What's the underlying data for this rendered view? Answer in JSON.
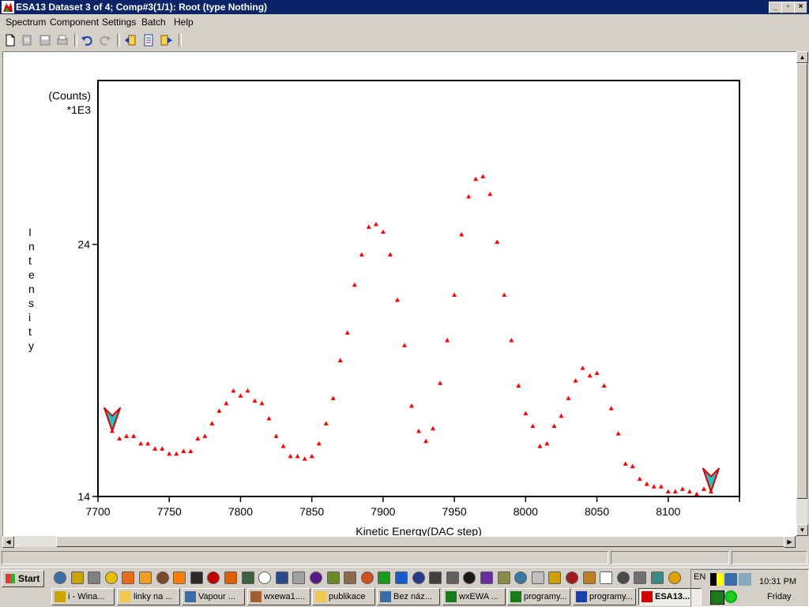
{
  "window": {
    "title": "ESA13 Dataset 3 of 4; Comp#3(1/1): Root (type Nothing)"
  },
  "window_controls": {
    "minimize": "_",
    "maximize": "▫",
    "close": "×"
  },
  "menu": [
    "Spectrum",
    "Component",
    "Settings",
    "Batch",
    "Help"
  ],
  "toolbar_icons": [
    "new-file-icon",
    "open-icon",
    "save-icon",
    "print-icon",
    "undo-icon",
    "redo-icon",
    "import-icon",
    "report-icon",
    "export-icon"
  ],
  "chart_data": {
    "type": "scatter",
    "title": "",
    "xlabel": "Kinetic Energy(DAC step)",
    "ylabel": "Intensity",
    "y_unit_line1": "(Counts)",
    "y_unit_line2": "*1E3",
    "xlim": [
      7700,
      8150
    ],
    "ylim": [
      14,
      30.5
    ],
    "xticks": [
      7700,
      7750,
      7800,
      7850,
      7900,
      7950,
      8000,
      8050,
      8100
    ],
    "yticks": [
      14,
      24
    ],
    "marker_color": "#ff0000",
    "cursor_color": "#1fc3c3",
    "cursors": [
      7710,
      8130
    ],
    "x": [
      7710,
      7715,
      7720,
      7725,
      7730,
      7735,
      7740,
      7745,
      7750,
      7755,
      7760,
      7765,
      7770,
      7775,
      7780,
      7785,
      7790,
      7795,
      7800,
      7805,
      7810,
      7815,
      7820,
      7825,
      7830,
      7835,
      7840,
      7845,
      7850,
      7855,
      7860,
      7865,
      7870,
      7875,
      7880,
      7885,
      7890,
      7895,
      7900,
      7905,
      7910,
      7915,
      7920,
      7925,
      7930,
      7935,
      7940,
      7945,
      7950,
      7955,
      7960,
      7965,
      7970,
      7975,
      7980,
      7985,
      7990,
      7995,
      8000,
      8005,
      8010,
      8015,
      8020,
      8025,
      8030,
      8035,
      8040,
      8045,
      8050,
      8055,
      8060,
      8065,
      8070,
      8075,
      8080,
      8085,
      8090,
      8095,
      8100,
      8105,
      8110,
      8115,
      8120,
      8125,
      8130
    ],
    "y": [
      16.6,
      16.3,
      16.4,
      16.4,
      16.1,
      16.1,
      15.9,
      15.9,
      15.7,
      15.7,
      15.8,
      15.8,
      16.3,
      16.4,
      16.9,
      17.4,
      17.7,
      18.2,
      18.0,
      18.2,
      17.8,
      17.7,
      17.1,
      16.4,
      16.0,
      15.6,
      15.6,
      15.5,
      15.6,
      16.1,
      16.9,
      17.9,
      19.4,
      20.5,
      22.4,
      23.6,
      24.7,
      24.8,
      24.5,
      23.6,
      21.8,
      20.0,
      17.6,
      16.6,
      16.2,
      16.7,
      18.5,
      20.2,
      22.0,
      24.4,
      25.9,
      26.6,
      26.7,
      26.0,
      24.1,
      22.0,
      20.2,
      18.4,
      17.3,
      16.8,
      16.0,
      16.1,
      16.8,
      17.2,
      17.9,
      18.6,
      19.1,
      18.8,
      18.9,
      18.4,
      17.5,
      16.5,
      15.3,
      15.2,
      14.7,
      14.5,
      14.4,
      14.4,
      14.2,
      14.2,
      14.3,
      14.2,
      14.1,
      14.3,
      14.2
    ]
  },
  "status": [
    "",
    "",
    ""
  ],
  "taskbar": {
    "start_label": "Start",
    "quicklaunch_icons": [
      "ie-icon",
      "pen-icon",
      "disk-icon",
      "flash-icon",
      "firefox-icon",
      "orange-icon",
      "coffee-icon",
      "vlc-icon",
      "eye-icon",
      "close-red-icon",
      "matlab-icon",
      "terminal-icon",
      "notepad-icon",
      "books-icon",
      "s-icon",
      "no-icon",
      "grid-icon",
      "photo-icon",
      "fox-icon",
      "flower-icon",
      "e-icon",
      "floppy-icon",
      "disk2-icon",
      "camera-icon",
      "g-icon",
      "purple-icon",
      "stack-icon",
      "monitor-icon",
      "cd-icon",
      "hand-icon",
      "bug-icon",
      "pen2-icon",
      "x-icon",
      "print-icon",
      "lock-icon",
      "chip-icon",
      "star-icon"
    ],
    "tasks": [
      {
        "label": "i - Wina...",
        "icon": "pen-icon"
      },
      {
        "label": "linky na ...",
        "icon": "folder-icon"
      },
      {
        "label": "Vapour ...",
        "icon": "ie-icon"
      },
      {
        "label": "wxewa1....",
        "icon": "app-icon"
      },
      {
        "label": "publikace",
        "icon": "folder-icon"
      },
      {
        "label": "Bez náz...",
        "icon": "window-icon"
      },
      {
        "label": "wxEWA ...",
        "icon": "chart-icon"
      },
      {
        "label": "programy...",
        "icon": "excel-icon"
      },
      {
        "label": "programy...",
        "icon": "word-icon"
      },
      {
        "label": "ESA13...",
        "icon": "esa-icon",
        "active": true
      }
    ],
    "language": "EN",
    "time": "10:31 PM",
    "day": "Friday"
  }
}
